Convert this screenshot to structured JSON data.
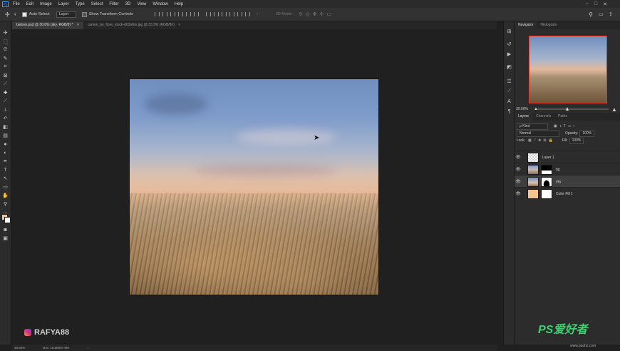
{
  "menubar": {
    "ps_logo": "Ps",
    "items": [
      "File",
      "Edit",
      "Image",
      "Layer",
      "Type",
      "Select",
      "Filter",
      "3D",
      "View",
      "Window",
      "Help"
    ],
    "window_controls": [
      "–",
      "□",
      "✕"
    ]
  },
  "options": {
    "auto_select_label": "Auto-Select:",
    "auto_select_value": "Layer",
    "transform_label": "Show Transform Controls",
    "mode_3d_label": "3D Mode:"
  },
  "tabs": [
    {
      "label": "baloon.psd @ 30.6% (sky, RGB/8) *",
      "close": "×"
    },
    {
      "label": "canion_by_fiore_stock-d63o6m.jpg @ 33.3% (RGB/8#)",
      "close": "×"
    }
  ],
  "navigator": {
    "tabs": [
      "Navigator",
      "Histogram"
    ],
    "zoom": "30.56%"
  },
  "layers_panel": {
    "tabs": [
      "Layers",
      "Channels",
      "Paths"
    ],
    "filter": "ρ Kind",
    "blend_mode": "Normal",
    "opacity_label": "Opacity:",
    "opacity_value": "100%",
    "lock_label": "Lock:",
    "fill_label": "Fill:",
    "fill_value": "100%",
    "layers": [
      {
        "name": "Layer 1",
        "selected": false,
        "thumb": "#bdbdbd",
        "has_mask": false
      },
      {
        "name": "bg",
        "selected": false,
        "thumb": "#8a93a8",
        "has_mask": true
      },
      {
        "name": "sky",
        "selected": true,
        "thumb": "#8fa1bf",
        "has_mask": true
      },
      {
        "name": "Color Fill 1",
        "selected": false,
        "thumb": "#f6c48e",
        "has_mask": true
      }
    ]
  },
  "status": {
    "zoom": "30.56%",
    "doc": "Doc: 15.0M/67.9M"
  },
  "watermark": {
    "handle": "RAFYA88",
    "site_logo": "PS爱好者",
    "site_url": "www.psahz.com"
  },
  "colors": {
    "accent": "#31a8ff",
    "navigator_frame": "#e0392b",
    "foreground_swatch": "#f6c48e",
    "background_swatch": "#ffffff"
  }
}
